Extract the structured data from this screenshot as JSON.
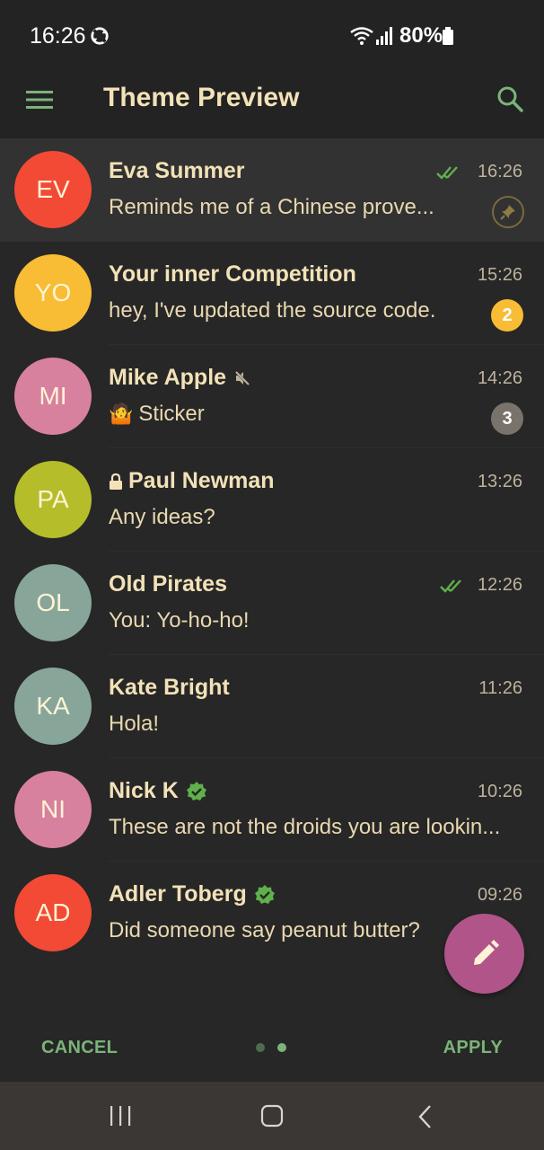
{
  "status_bar": {
    "time": "16:26",
    "battery": "80%"
  },
  "app_bar": {
    "title": "Theme Preview",
    "menu_icon": "hamburger-menu-icon",
    "search_icon": "search-icon"
  },
  "colors": {
    "accent_green": "#7bb478",
    "fab": "#b1548a",
    "title_text": "#f3e2b8",
    "background": "#272727"
  },
  "chats": [
    {
      "initials": "EV",
      "name": "Eva Summer",
      "message": "Reminds me of a Chinese prove...",
      "time": "16:26",
      "avatar_color": "#f24a35",
      "read_check": true,
      "pinned": true
    },
    {
      "initials": "YO",
      "name": "Your inner Competition",
      "message": "hey, I've updated the source code.",
      "time": "15:26",
      "avatar_color": "#f8bd34",
      "badge": "2",
      "badge_color": "#f8bd34"
    },
    {
      "initials": "MI",
      "name": "Mike Apple",
      "message": "Sticker",
      "time": "14:26",
      "avatar_color": "#d7819f",
      "muted": true,
      "sticker_emoji": "🤷",
      "badge": "3",
      "badge_color": "#7a736b"
    },
    {
      "initials": "PA",
      "name": "Paul Newman",
      "message": "Any ideas?",
      "time": "13:26",
      "avatar_color": "#b5bd2a",
      "secret": true
    },
    {
      "initials": "OL",
      "name": "Old Pirates",
      "message": "You: Yo-ho-ho!",
      "time": "12:26",
      "avatar_color": "#87a699",
      "read_check": true
    },
    {
      "initials": "KA",
      "name": "Kate Bright",
      "message": "Hola!",
      "time": "11:26",
      "avatar_color": "#87a699"
    },
    {
      "initials": "NI",
      "name": "Nick K",
      "message": "These are not the droids you are lookin...",
      "time": "10:26",
      "avatar_color": "#d7819f",
      "verified": true
    },
    {
      "initials": "AD",
      "name": "Adler Toberg",
      "message": "Did someone say peanut butter?",
      "time": "09:26",
      "avatar_color": "#f24a35",
      "verified": true
    }
  ],
  "fab": {
    "icon": "pencil-icon"
  },
  "bottom_bar": {
    "cancel_label": "CANCEL",
    "apply_label": "APPLY",
    "page_count": 2,
    "active_page": 2
  }
}
